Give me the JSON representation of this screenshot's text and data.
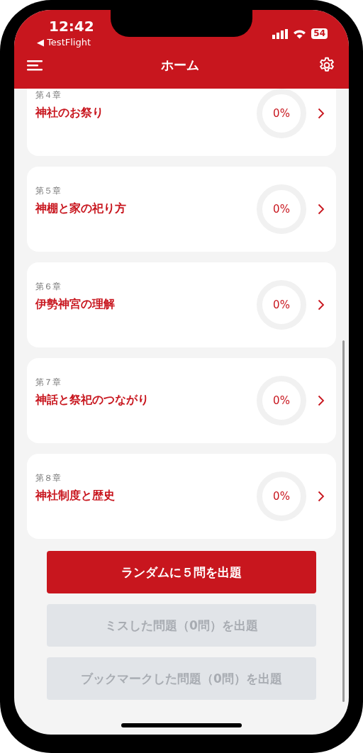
{
  "status_bar": {
    "time": "12:42",
    "back_app": "◀ TestFlight",
    "battery": "54"
  },
  "nav_bar": {
    "title": "ホーム"
  },
  "chapters": [
    {
      "number": "第４章",
      "title": "神社のお祭り",
      "progress": "0%"
    },
    {
      "number": "第５章",
      "title": "神棚と家の祀り方",
      "progress": "0%"
    },
    {
      "number": "第６章",
      "title": "伊勢神宮の理解",
      "progress": "0%"
    },
    {
      "number": "第７章",
      "title": "神話と祭祀のつながり",
      "progress": "0%"
    },
    {
      "number": "第８章",
      "title": "神社制度と歴史",
      "progress": "0%"
    }
  ],
  "buttons": [
    {
      "label": "ランダムに５問を出題",
      "disabled": false
    },
    {
      "label": "ミスした問題（0問）を出題",
      "disabled": true
    },
    {
      "label": "ブックマークした問題（0問）を出題",
      "disabled": true
    }
  ]
}
